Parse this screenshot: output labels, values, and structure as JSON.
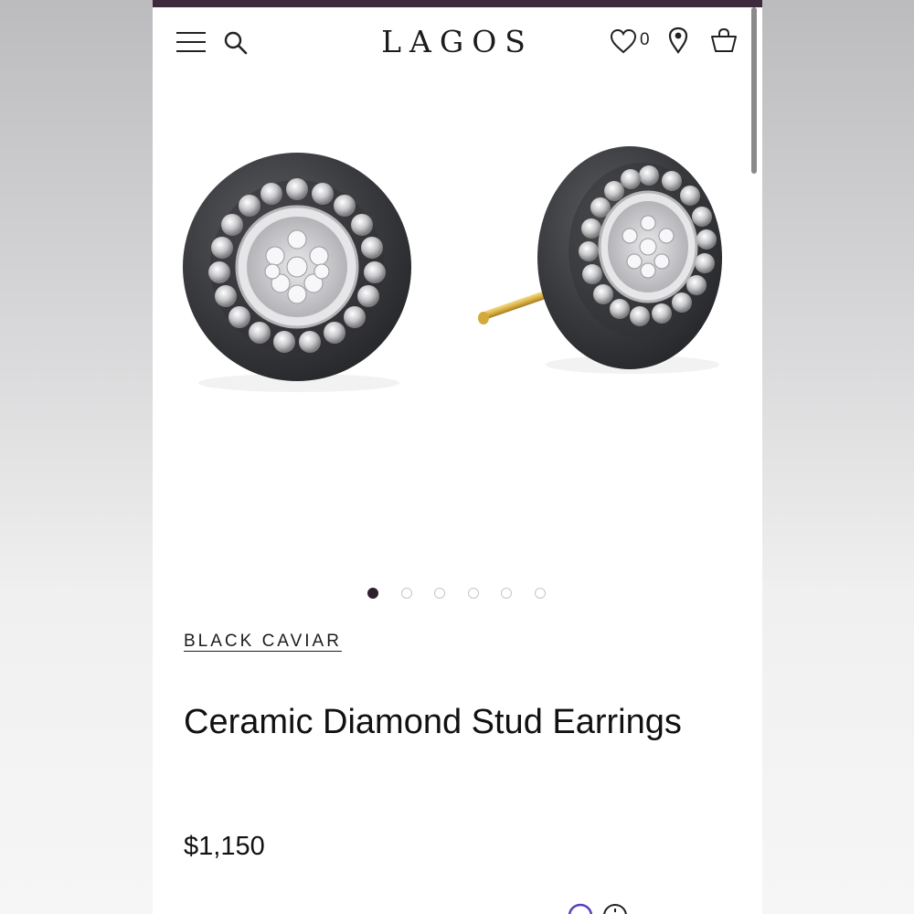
{
  "header": {
    "logo": "LAGOS",
    "wishlist_count": "0",
    "icons": [
      "menu-icon",
      "search-icon",
      "heart-icon",
      "location-pin-icon",
      "shopping-bag-icon"
    ]
  },
  "carousel": {
    "total_slides": 6,
    "active_index": 0
  },
  "product": {
    "collection": "BLACK CAVIAR",
    "title": "Ceramic Diamond Stud Earrings",
    "price": "$1,150"
  },
  "colors": {
    "accent": "#3d2b3d",
    "text": "#111111"
  }
}
